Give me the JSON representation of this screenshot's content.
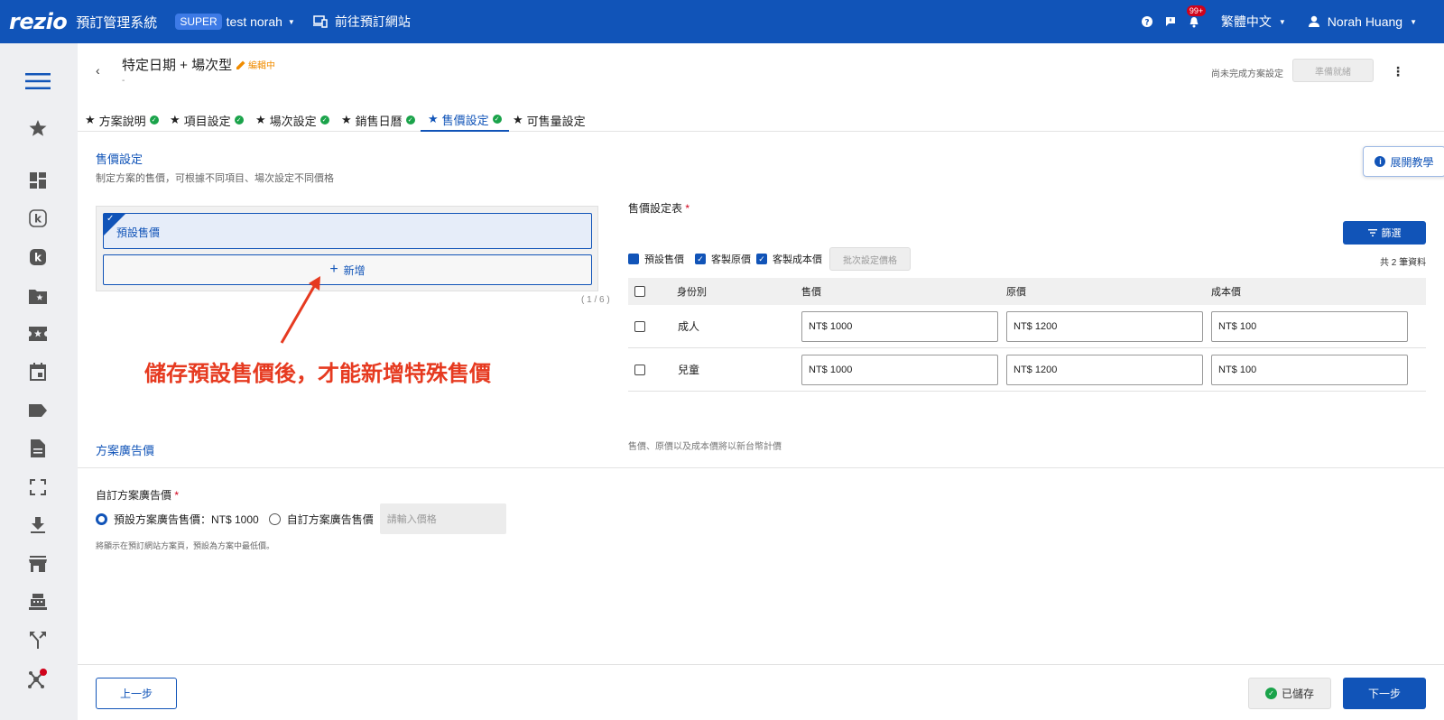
{
  "topbar": {
    "logo": "rezio",
    "system_name": "預訂管理系統",
    "badge": "SUPER",
    "tenant": "test norah",
    "goto_site": "前往預訂網站",
    "notification_count": "99+",
    "language": "繁體中文",
    "user": "Norah Huang"
  },
  "header": {
    "title": "特定日期 + 場次型",
    "status": "編輯中",
    "subtitle": "-",
    "incomplete_note": "尚未完成方案設定",
    "ready_button": "準備就緒"
  },
  "tabs": [
    {
      "label": "方案說明",
      "done": true
    },
    {
      "label": "項目設定",
      "done": true
    },
    {
      "label": "場次設定",
      "done": true
    },
    {
      "label": "銷售日曆",
      "done": true
    },
    {
      "label": "售價設定",
      "done": true
    },
    {
      "label": "可售量設定",
      "done": false
    }
  ],
  "price_section": {
    "title": "售價設定",
    "description": "制定方案的售價，可根據不同項目、場次設定不同價格",
    "tutorial_button": "展開教學",
    "default_price_item": "預設售價",
    "add_button": "新增",
    "counter": "( 1 / 6 )",
    "annotation": "儲存預設售價後，才能新增特殊售價"
  },
  "price_table": {
    "label": "售價設定表",
    "required_mark": "*",
    "filter_button": "篩選",
    "checkboxes": [
      {
        "label": "預設售價",
        "checked": true
      },
      {
        "label": "客製原價",
        "checked": true
      },
      {
        "label": "客製成本價",
        "checked": true
      }
    ],
    "batch_button": "批次設定價格",
    "total": "共 2 筆資料",
    "headers": [
      "身份別",
      "售價",
      "原價",
      "成本價"
    ],
    "rows": [
      {
        "identity": "成人",
        "price": "NT$ 1000",
        "original": "NT$ 1200",
        "cost": "NT$ 100"
      },
      {
        "identity": "兒童",
        "price": "NT$ 1000",
        "original": "NT$ 1200",
        "cost": "NT$ 100"
      }
    ],
    "note": "售價、原價以及成本價將以新台幣計價"
  },
  "ad_price": {
    "title": "方案廣告價",
    "label": "自訂方案廣告價",
    "required_mark": "*",
    "option_default": "預設方案廣告售價：NT$ 1000",
    "option_custom": "自訂方案廣告售價",
    "input_placeholder": "請輸入價格",
    "note": "將顯示在預訂網站方案頁，預設為方案中最低價。"
  },
  "footer": {
    "prev_button": "上一步",
    "saved_button": "已儲存",
    "next_button": "下一步"
  },
  "colors": {
    "brand": "#1154b8",
    "success": "#1aa34a",
    "warning": "#f08c00",
    "annotation": "#e63a20"
  }
}
